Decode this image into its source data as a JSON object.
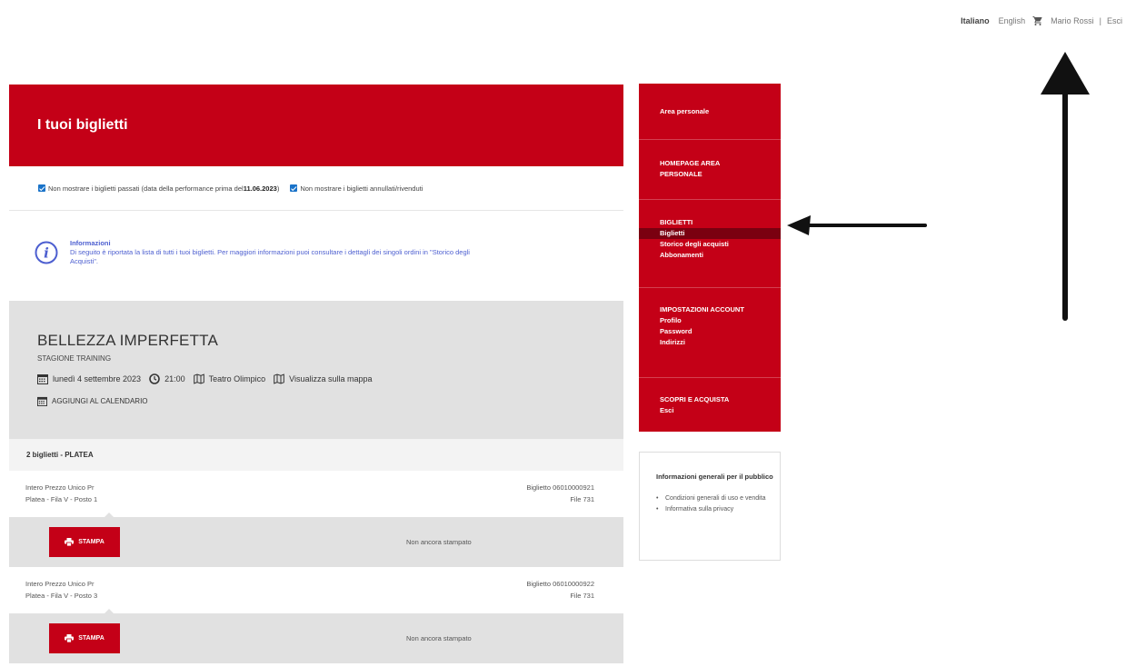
{
  "topbar": {
    "lang_it": "Italiano",
    "lang_en": "English",
    "user": "Mario Rossi",
    "separator": "|",
    "logout": "Esci"
  },
  "header": {
    "title": "I tuoi biglietti"
  },
  "filters": {
    "past_prefix": "Non mostrare i biglietti passati (data della performance prima del ",
    "past_date": "11.06.2023",
    "past_suffix": ")",
    "cancelled": "Non mostrare i biglietti annullati/rivenduti"
  },
  "info": {
    "title": "Informazioni",
    "text_line1": "Di seguito è riportata la lista di tutti i tuoi biglietti. Per maggiori informazioni puoi consultare i dettagli dei singoli ordini in \"Storico degli",
    "text_line2": "Acquisti\"."
  },
  "event": {
    "title": "BELLEZZA IMPERFETTA",
    "season": "STAGIONE TRAINING",
    "date": "lunedì 4 settembre 2023",
    "time": "21:00",
    "venue": "Teatro Olimpico",
    "map_link": "Visualizza sulla mappa",
    "add_calendar": "AGGIUNGI AL CALENDARIO"
  },
  "group": {
    "heading": "2 biglietti - PLATEA"
  },
  "tickets": [
    {
      "type": "Intero Prezzo Unico Pr",
      "seat": "Platea - Fila V - Posto 1",
      "number": "Biglietto 06010000921",
      "file": "File 731",
      "print_label": "STAMPA",
      "status": "Non ancora stampato"
    },
    {
      "type": "Intero Prezzo Unico Pr",
      "seat": "Platea - Fila V - Posto 3",
      "number": "Biglietto 06010000922",
      "file": "File 731",
      "print_label": "STAMPA",
      "status": "Non ancora stampato"
    }
  ],
  "sidebar": {
    "area_title": "Area personale",
    "home_line1": "HOMEPAGE AREA",
    "home_line2": "PERSONALE",
    "tickets_head": "BIGLIETTI",
    "tickets_items": [
      "Biglietti",
      "Storico degli acquisti",
      "Abbonamenti"
    ],
    "account_head": "IMPOSTAZIONI ACCOUNT",
    "account_items": [
      "Profilo",
      "Password",
      "Indirizzi"
    ],
    "discover_head": "SCOPRI E ACQUISTA",
    "discover_items": [
      "Esci"
    ]
  },
  "infobox": {
    "title": "Informazioni generali per il pubblico",
    "links": [
      "Condizioni generali di uso e vendita",
      "Informativa sulla privacy"
    ]
  },
  "colors": {
    "brand_red": "#c40017",
    "active_red": "#7a0010",
    "info_blue": "#4d5fd0",
    "checkbox_blue": "#1a73c9"
  }
}
